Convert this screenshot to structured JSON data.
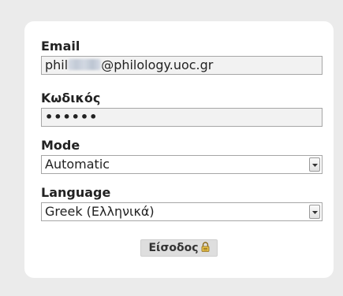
{
  "form": {
    "email": {
      "label": "Email",
      "value_prefix": "phil",
      "value_suffix": "@philology.uoc.gr"
    },
    "password": {
      "label": "Κωδικός",
      "value": "••••••"
    },
    "mode": {
      "label": "Mode",
      "selected": "Automatic"
    },
    "language": {
      "label": "Language",
      "selected": "Greek (Ελληνικά)"
    },
    "submit_label": "Είσοδος"
  },
  "icons": {
    "lock": "lock-icon",
    "dropdown": "chevron-down-icon"
  },
  "colors": {
    "background": "#ebebeb",
    "card": "#ffffff",
    "field_fill": "#f2f2f2",
    "button": "#dedede"
  }
}
